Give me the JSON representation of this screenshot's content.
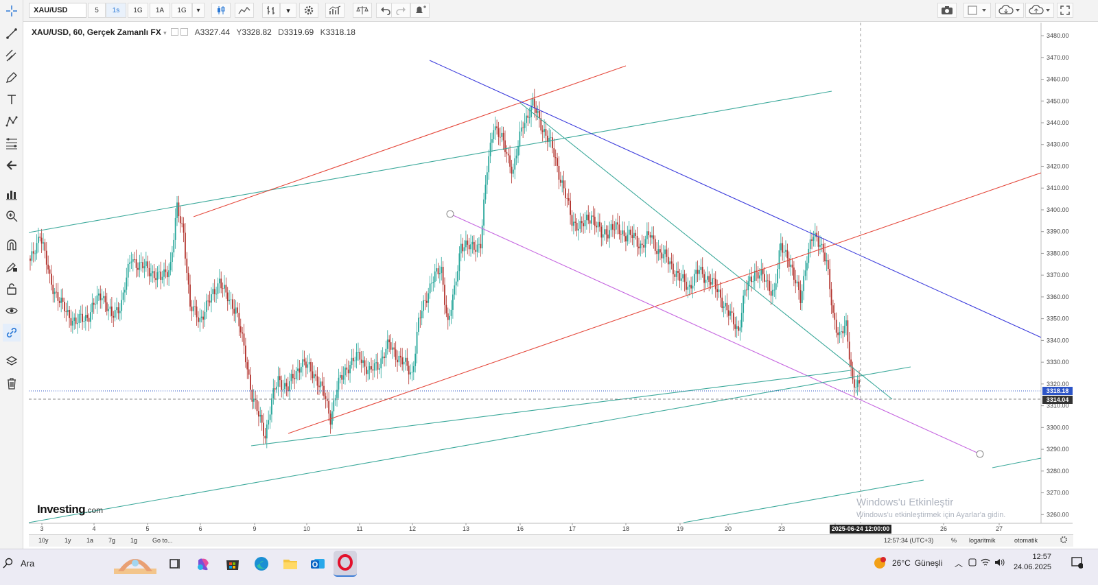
{
  "toolbar": {
    "symbol": "XAU/USD",
    "timeframes": [
      "5",
      "1s",
      "1G",
      "1A",
      "1G"
    ],
    "active_timeframe_index": 1
  },
  "legend": {
    "title": "XAU/USD, 60, Gerçek Zamanlı FX",
    "open_label": "A",
    "open": "3327.44",
    "high_label": "Y",
    "high": "3328.82",
    "low_label": "D",
    "low": "3319.69",
    "close_label": "K",
    "close": "3318.18"
  },
  "chart_data": {
    "type": "candlestick",
    "y_ticks": [
      3480,
      3470,
      3460,
      3450,
      3440,
      3430,
      3420,
      3410,
      3400,
      3390,
      3380,
      3370,
      3360,
      3350,
      3340,
      3330,
      3320,
      3310,
      3300,
      3290,
      3280,
      3270,
      3260
    ],
    "x_ticks": [
      "3",
      "4",
      "5",
      "6",
      "9",
      "10",
      "11",
      "12",
      "13",
      "16",
      "17",
      "18",
      "19",
      "20",
      "23",
      "24",
      "26",
      "27"
    ],
    "ylim": [
      3256,
      3486
    ],
    "current_price": "3318.18",
    "second_price": "3314.04",
    "crosshair_date": "2025-06-24 12:00:00"
  },
  "bottom": {
    "ranges": [
      "10y",
      "1y",
      "1a",
      "7g",
      "1g"
    ],
    "goto": "Go to...",
    "time": "12:57:34 (UTC+3)",
    "percent": "%",
    "log": "logaritmik",
    "auto": "otomatik"
  },
  "watermark": {
    "line1": "Windows'u Etkinleştir",
    "line2": "Windows'u etkinleştirmek için Ayarlar'a gidin."
  },
  "brand": {
    "name": "Investing",
    "suffix": ".com"
  },
  "taskbar": {
    "search_label": "Ara",
    "weather_temp": "26°C",
    "weather_text": "Güneşli",
    "clock_time": "12:57",
    "clock_date": "24.06.2025"
  },
  "colors": {
    "up": "#26a69a",
    "down": "#b2322c",
    "blue_line": "#3b3bdc",
    "red_line": "#e4473a",
    "teal_line": "#3aa89a",
    "purple_line": "#c566e0",
    "price_tag": "#2d55c7",
    "price_tag2": "#333333"
  }
}
